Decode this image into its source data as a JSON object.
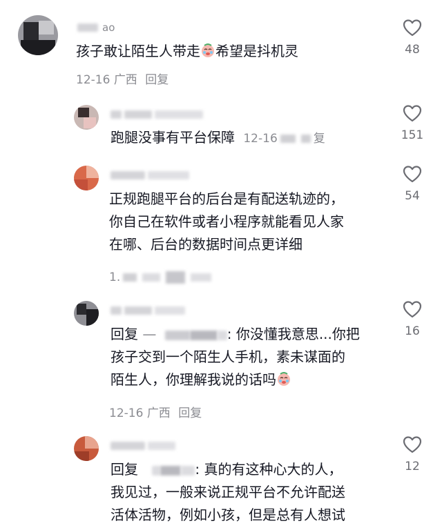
{
  "comments": [
    {
      "name_suffix": "ao",
      "lines": [
        "孩子敢让陌生人带走",
        "希望是抖机灵"
      ],
      "meta": {
        "date": "12-16",
        "region": "广西",
        "reply": "回复"
      },
      "likes": "48"
    },
    {
      "lines": [
        "跑腿没事有平台保障"
      ],
      "meta": {
        "date": "12-16",
        "reply_suffix": "复"
      },
      "likes": "151"
    },
    {
      "lines": [
        "正规跑腿平台的后台是有配送轨迹的，",
        "你自己在软件或者小程序就能看见人家",
        "在哪、后台的数据时间点更详细"
      ],
      "meta": {
        "date_prefix": "1."
      },
      "likes": "54"
    },
    {
      "prefix": "回复 ",
      "dash": "—",
      "after_name": ": 你没懂我意思...你把",
      "lines": [
        "孩子交到一个陌生人手机，素未谋面的",
        "陌生人，你理解我说的话吗"
      ],
      "meta": {
        "date": "12-16",
        "region": "广西",
        "reply": "回复"
      },
      "likes": "16"
    },
    {
      "prefix": "回复",
      "after_name": ": 真的有这种心大的人，",
      "lines": [
        "我见过，一般来说正规平台不允许配送",
        "活体活物，例如小孩，但是总有人想试"
      ],
      "likes": "12"
    }
  ],
  "icons": {
    "like": "heart-outline-icon",
    "emoji": "crying-face-emoji"
  },
  "colors": {
    "text": "#161823",
    "meta": "#8a8b91",
    "bg": "#ffffff"
  }
}
